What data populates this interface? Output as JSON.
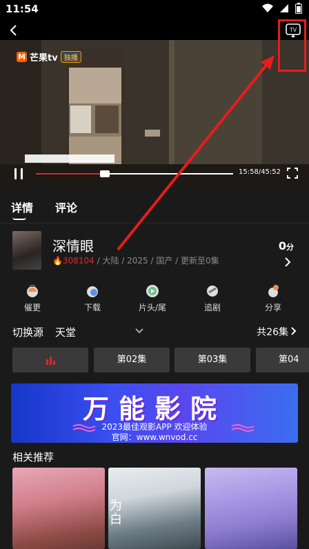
{
  "status_bar": {
    "time": "11:54"
  },
  "player": {
    "logo_text": "芒果tv",
    "logo_tag": "独播",
    "current_time": "15:58",
    "total_time": "45:52",
    "time_display": "15:58/45:52",
    "progress": 0.35
  },
  "tabs": [
    {
      "label": "详情"
    },
    {
      "label": "评论"
    }
  ],
  "show": {
    "title": "深情眼",
    "hot_count": "308104",
    "meta": " / 大陆 / 2025 / 国产 / 更新至0集",
    "score_value": "0",
    "score_unit": "分"
  },
  "actions": [
    {
      "label": "催更",
      "icon": "urge-icon"
    },
    {
      "label": "下载",
      "icon": "download-icon"
    },
    {
      "label": "片头/尾",
      "icon": "skip-intro-icon"
    },
    {
      "label": "追剧",
      "icon": "follow-icon"
    },
    {
      "label": "分享",
      "icon": "share-icon"
    }
  ],
  "source": {
    "label": "切换源",
    "value": "天堂",
    "episode_count": "共26集"
  },
  "episodes": [
    {
      "label": "",
      "playing": true
    },
    {
      "label": "第02集"
    },
    {
      "label": "第03集"
    },
    {
      "label": "第04"
    }
  ],
  "banner": {
    "title": "万能影院",
    "subtitle": "2023最佳观影APP 欢迎体验",
    "url": "官网：www.wnvod.cc"
  },
  "recommendations": {
    "title": "相关推荐",
    "poster_2_text": "为\n白"
  },
  "colors": {
    "accent": "#e0262b",
    "annotation": "#e81c1c",
    "banner": "#3b4ef0"
  }
}
